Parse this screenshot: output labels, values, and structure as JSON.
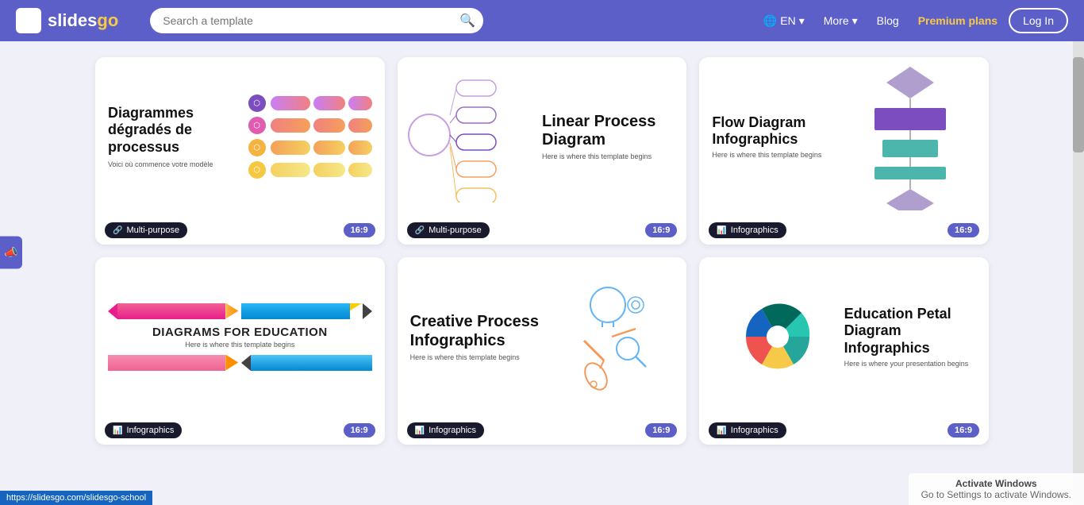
{
  "header": {
    "logo_text_slides": "slides",
    "logo_text_go": "go",
    "search_placeholder": "Search a template",
    "lang_label": "EN",
    "more_label": "More",
    "blog_label": "Blog",
    "premium_label": "Premium plans",
    "login_label": "Log In"
  },
  "cards": [
    {
      "id": "card-1",
      "tag": "Multi-purpose",
      "ratio": "16:9",
      "title": "Diagrammes dégradés de processus",
      "subtitle": "Voici où commence votre modèle"
    },
    {
      "id": "card-2",
      "tag": "Multi-purpose",
      "ratio": "16:9",
      "title": "Linear Process Diagram",
      "subtitle": "Here is where this template begins"
    },
    {
      "id": "card-3",
      "tag": "Infographics",
      "ratio": "16:9",
      "title": "Flow Diagram Infographics",
      "subtitle": "Here is where this template begins"
    },
    {
      "id": "card-4",
      "tag": "Infographics",
      "ratio": "16:9",
      "title": "DIAGRAMS FOR EDUCATION",
      "subtitle": "Here is where this template begins"
    },
    {
      "id": "card-5",
      "tag": "Infographics",
      "ratio": "16:9",
      "title": "Creative Process Infographics",
      "subtitle": "Here is where this template begins"
    },
    {
      "id": "card-6",
      "tag": "Infographics",
      "ratio": "16:9",
      "title": "Education Petal Diagram Infographics",
      "subtitle": "Here is where your presentation begins"
    }
  ],
  "status_url": "https://slidesgo.com/slidesgo-school",
  "windows_activate_title": "Activate Windows",
  "windows_activate_msg": "Go to Settings to activate Windows."
}
